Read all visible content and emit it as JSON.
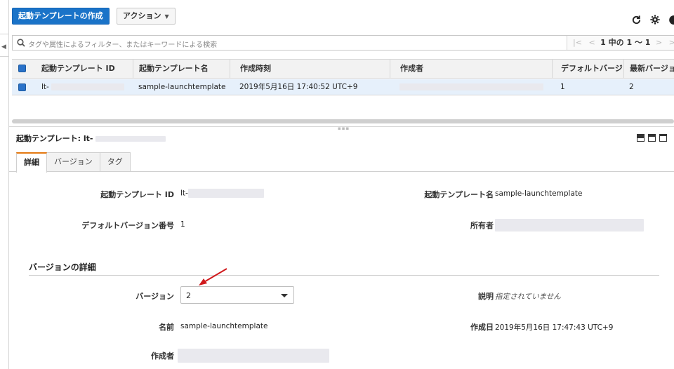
{
  "toolbar": {
    "create_label": "起動テンプレートの作成",
    "action_label": "アクション",
    "icons": [
      "refresh-icon",
      "gear-icon",
      "help-icon"
    ]
  },
  "search": {
    "placeholder": "タグや属性によるフィルター、またはキーワードによる検索"
  },
  "pager": {
    "count_text": "1 中の 1 〜 1",
    "first": "|<",
    "prev": "<",
    "next": ">",
    "last": ">|"
  },
  "table": {
    "columns": [
      "起動テンプレート ID",
      "起動テンプレート名",
      "作成時刻",
      "作成者",
      "デフォルトバージ",
      "最新バージョン"
    ],
    "rows": [
      {
        "id": "lt-",
        "name": "sample-launchtemplate",
        "created": "2019年5月16日 17:40:52 UTC+9",
        "creator": "",
        "default_version": "1",
        "latest_version": "2"
      }
    ]
  },
  "detail": {
    "title": "起動テンプレート: lt-",
    "tabs": [
      "詳細",
      "バージョン",
      "タグ"
    ],
    "fields": {
      "id_label": "起動テンプレート ID",
      "id_value": "lt-",
      "name_label": "起動テンプレート名",
      "name_value": "sample-launchtemplate",
      "default_version_label": "デフォルトバージョン番号",
      "default_version_value": "1",
      "owner_label": "所有者",
      "owner_value": ""
    },
    "version_section": {
      "title": "バージョンの詳細",
      "version_label": "バージョン",
      "version_selected": "2",
      "description_label": "説明",
      "description_value": "指定されていません",
      "name_label": "名前",
      "name_value": "sample-launchtemplate",
      "created_label": "作成日",
      "created_value": "2019年5月16日 17:47:43 UTC+9",
      "creator_label": "作成者",
      "creator_value": ""
    }
  },
  "colors": {
    "primary": "#1a73c8",
    "selected_row": "#e6f0fb",
    "tab_accent": "#e47911",
    "annotation_arrow": "#d0191c"
  }
}
